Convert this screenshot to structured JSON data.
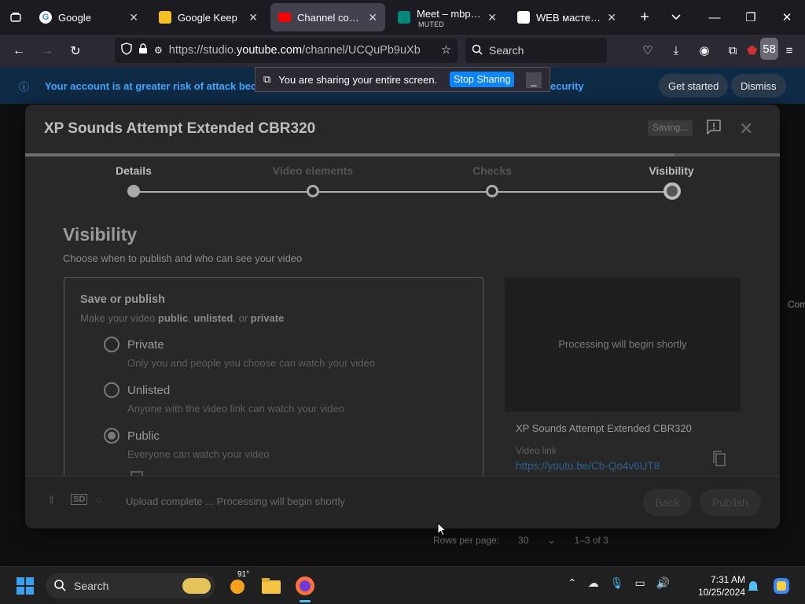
{
  "browser": {
    "tabs": [
      {
        "title": "Google",
        "favicon_color": "#ffffff",
        "active": false
      },
      {
        "title": "Google Keep",
        "favicon_color": "#f6bf26",
        "active": false
      },
      {
        "title": "Channel content",
        "favicon_color": "#ff0000",
        "active": true
      },
      {
        "title": "Meet – mbp-bm",
        "subtitle": "MUTED",
        "favicon_color": "#00897b",
        "active": false
      },
      {
        "title": "WEB мастерская",
        "favicon_color": "#ffffff",
        "active": false
      }
    ],
    "url_prefix": "https://studio.",
    "url_host": "youtube.com",
    "url_path": "/channel/UCQuPb9uXb",
    "search_placeholder": "Search",
    "extensions_badge": "58"
  },
  "banner": {
    "text": "Your account is at greater risk of attack beca",
    "text_tail": "ecurity",
    "get_started": "Get started",
    "dismiss": "Dismiss"
  },
  "share_bar": {
    "text": "You are sharing your entire screen.",
    "stop": "Stop Sharing"
  },
  "dialog": {
    "title": "XP Sounds Attempt Extended CBR320",
    "saving": "Saving...",
    "steps": [
      "Details",
      "Video elements",
      "Checks",
      "Visibility"
    ],
    "heading": "Visibility",
    "subheading": "Choose when to publish and who can see your video",
    "save_or_publish": {
      "title": "Save or publish",
      "desc_prefix": "Make your video ",
      "desc_public": "public",
      "desc_sep1": ", ",
      "desc_unlisted": "unlisted",
      "desc_sep2": ", or ",
      "desc_private": "private",
      "options": [
        {
          "label": "Private",
          "desc": "Only you and people you choose can watch your video",
          "selected": false
        },
        {
          "label": "Unlisted",
          "desc": "Anyone with the video link can watch your video",
          "selected": false
        },
        {
          "label": "Public",
          "desc": "Everyone can watch your video",
          "selected": true
        }
      ]
    },
    "preview": {
      "processing": "Processing will begin shortly",
      "title": "XP Sounds Attempt Extended CBR320",
      "link_label": "Video link",
      "link": "https://youtu.be/Cb-Qo4v6UT8"
    },
    "footer": {
      "sd": "SD",
      "status": "Upload complete ... Processing will begin shortly",
      "back": "Back",
      "publish": "Publish"
    }
  },
  "page": {
    "rows_per_page_label": "Rows per page:",
    "rows_per_page": "30",
    "range": "1–3 of 3",
    "side_text": "Com"
  },
  "taskbar": {
    "search": "Search",
    "weather": "91°",
    "time": "7:31 AM",
    "date": "10/25/2024"
  }
}
